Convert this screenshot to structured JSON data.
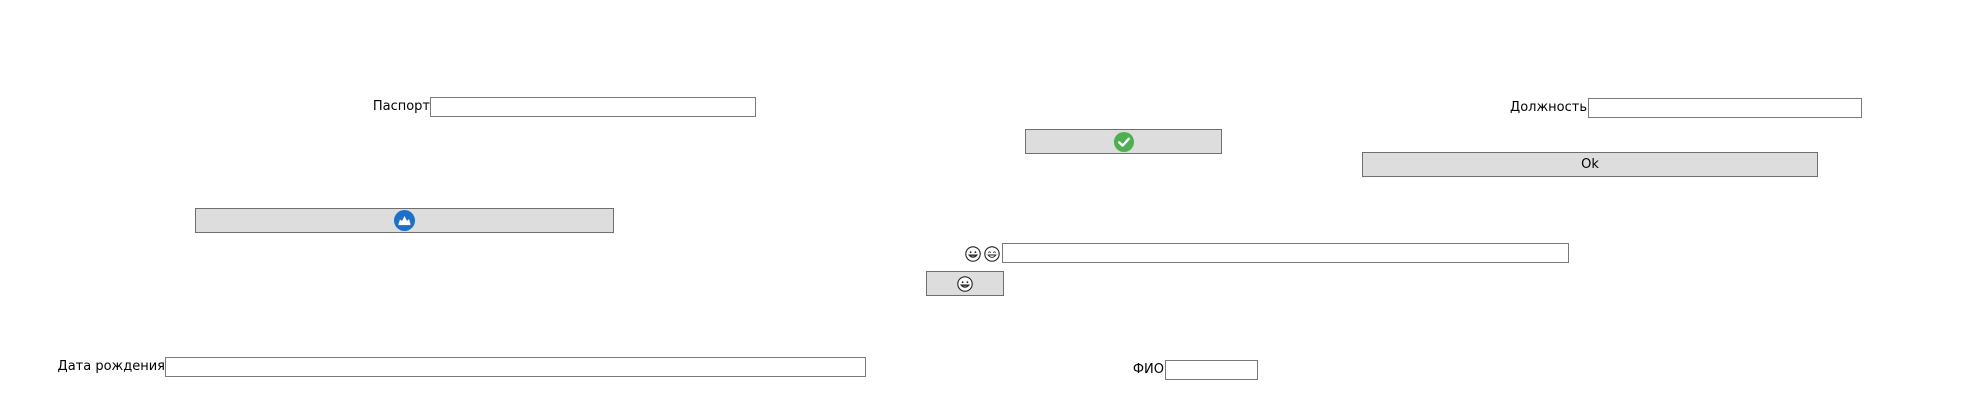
{
  "fields": {
    "passport": {
      "label": "Паспорт",
      "value": ""
    },
    "position": {
      "label": "Должность",
      "value": ""
    },
    "birth_date": {
      "label": "Дата рождения",
      "value": ""
    },
    "full_name": {
      "label": "ФИО",
      "value": ""
    },
    "emoji_field": {
      "value": ""
    }
  },
  "buttons": {
    "ok_label": "Ok"
  },
  "icons": {
    "check_button_icon": "check-circle-icon",
    "blue_button_icon": "cloud-badge-icon",
    "emoji_button_icon": "grinning-face-icon",
    "emoji_label_icons": [
      "grinning-face-icon",
      "laughing-face-icon"
    ]
  },
  "colors": {
    "button_bg": "#dddddd",
    "check_green": "#4caf50",
    "badge_blue": "#1e6fc8"
  }
}
